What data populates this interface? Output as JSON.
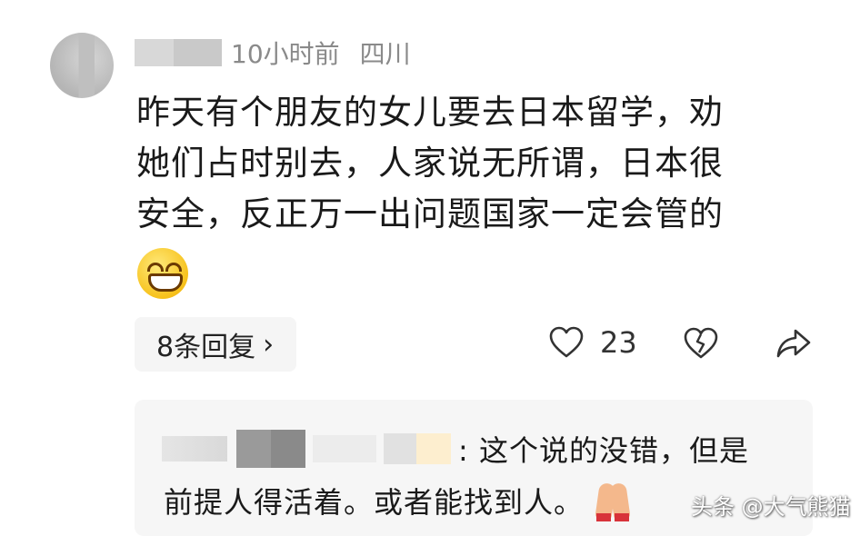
{
  "comment": {
    "time": "10小时前",
    "location": "四川",
    "lines": [
      "昨天有个朋友的女儿要去日本留学，劝",
      "她们占时别去，人家说无所谓，日本很",
      "安全，反正万一出问题国家一定会管的"
    ],
    "replies_label": "8条回复",
    "replies_chevron": "›",
    "like_count": "23"
  },
  "reply": {
    "text_line1": ": 这个说的没错，但是",
    "text_line2": "前提人得活着。或者能找到人。"
  },
  "watermark": "头条 @大气熊猫",
  "colors": {
    "text": "#1a1a1a",
    "meta": "#8a8a8a",
    "reply_bg": "#f6f6f6"
  }
}
